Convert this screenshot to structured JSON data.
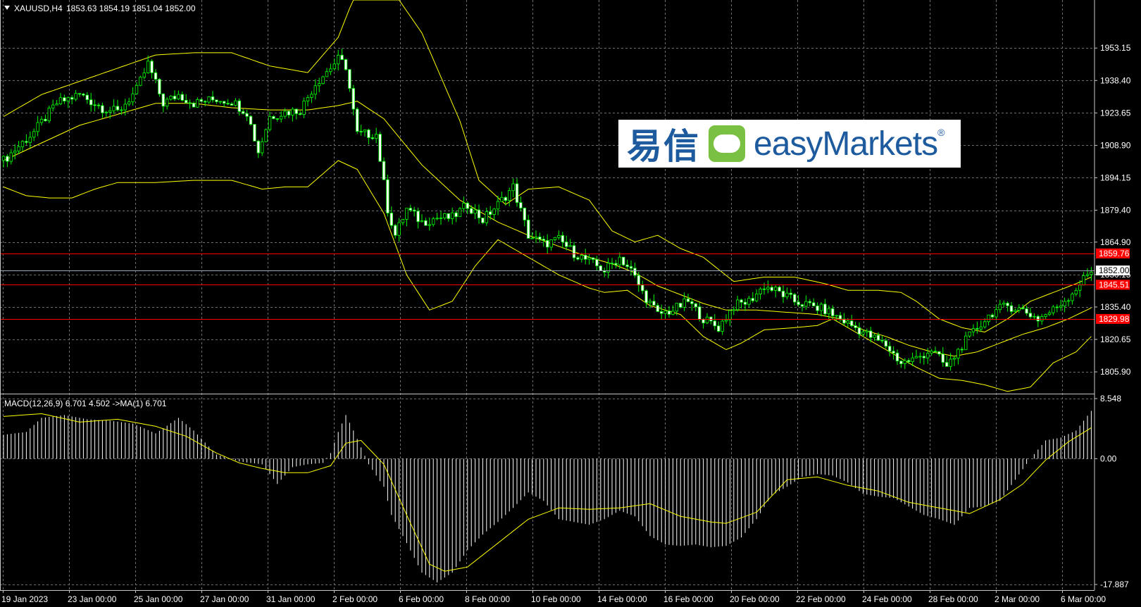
{
  "header": {
    "symbol": "XAUUSD,H4",
    "ohlc": "1853.63 1854.19 1851.04 1852.00"
  },
  "macd_label": "MACD(12,26,9) 6.701 4.502  ->MA(1) 6.701",
  "logo": {
    "cn": "易信",
    "en": "easyMarkets",
    "reg": "®"
  },
  "colors": {
    "background": "#000000",
    "grid": "#6e6e6e",
    "bull": "#00ff00",
    "bear": "#ffffff",
    "bands": "#ffff00",
    "level_lines": "#ff0000",
    "price_line": "#9aa8b8",
    "macd_hist": "#ffffff",
    "macd_signal": "#ffff00"
  },
  "chart_data": [
    {
      "type": "candlestick",
      "title": "XAUUSD,H4",
      "ylim": [
        1796,
        1975
      ],
      "y_ticks": [
        "1953.15",
        "1938.40",
        "1923.65",
        "1908.90",
        "1894.15",
        "1879.40",
        "1864.90",
        "1850.15",
        "1835.40",
        "1820.65",
        "1805.90"
      ],
      "x_labels": [
        "19 Jan 2023",
        "23 Jan 00:00",
        "25 Jan 00:00",
        "27 Jan 00:00",
        "31 Jan 00:00",
        "2 Feb 00:00",
        "6 Feb 00:00",
        "8 Feb 00:00",
        "10 Feb 00:00",
        "14 Feb 00:00",
        "16 Feb 00:00",
        "20 Feb 00:00",
        "22 Feb 00:00",
        "24 Feb 00:00",
        "28 Feb 00:00",
        "2 Mar 00:00",
        "6 Mar 00:00"
      ],
      "current_price": "1852.00",
      "levels": [
        "1859.76",
        "1845.51",
        "1829.98"
      ],
      "close_path": [
        [
          0,
          1902
        ],
        [
          8,
          1915
        ],
        [
          14,
          1928
        ],
        [
          20,
          1932
        ],
        [
          26,
          1926
        ],
        [
          30,
          1924
        ],
        [
          35,
          1934
        ],
        [
          38,
          1946
        ],
        [
          42,
          1928
        ],
        [
          46,
          1932
        ],
        [
          50,
          1928
        ],
        [
          56,
          1930
        ],
        [
          60,
          1929
        ],
        [
          64,
          1924
        ],
        [
          67,
          1906
        ],
        [
          70,
          1922
        ],
        [
          74,
          1924
        ],
        [
          78,
          1925
        ],
        [
          82,
          1937
        ],
        [
          88,
          1948
        ],
        [
          90,
          1945
        ],
        [
          93,
          1914
        ],
        [
          98,
          1914
        ],
        [
          101,
          1880
        ],
        [
          103,
          1868
        ],
        [
          106,
          1880
        ],
        [
          110,
          1874
        ],
        [
          114,
          1876
        ],
        [
          118,
          1876
        ],
        [
          122,
          1882
        ],
        [
          126,
          1875
        ],
        [
          130,
          1882
        ],
        [
          134,
          1890
        ],
        [
          138,
          1868
        ],
        [
          142,
          1864
        ],
        [
          146,
          1866
        ],
        [
          150,
          1860
        ],
        [
          154,
          1856
        ],
        [
          158,
          1852
        ],
        [
          162,
          1858
        ],
        [
          165,
          1852
        ],
        [
          168,
          1842
        ],
        [
          172,
          1832
        ],
        [
          176,
          1834
        ],
        [
          180,
          1838
        ],
        [
          184,
          1830
        ],
        [
          188,
          1826
        ],
        [
          192,
          1836
        ],
        [
          196,
          1838
        ],
        [
          200,
          1845
        ],
        [
          204,
          1842
        ],
        [
          208,
          1838
        ],
        [
          212,
          1836
        ],
        [
          216,
          1834
        ],
        [
          220,
          1830
        ],
        [
          224,
          1826
        ],
        [
          228,
          1822
        ],
        [
          232,
          1818
        ],
        [
          236,
          1810
        ],
        [
          240,
          1812
        ],
        [
          244,
          1816
        ],
        [
          248,
          1808
        ],
        [
          252,
          1818
        ],
        [
          256,
          1826
        ],
        [
          260,
          1833
        ],
        [
          264,
          1836
        ],
        [
          268,
          1834
        ],
        [
          272,
          1830
        ],
        [
          276,
          1834
        ],
        [
          280,
          1840
        ],
        [
          284,
          1848
        ],
        [
          286,
          1852
        ]
      ],
      "bb_upper": [
        [
          0,
          1922
        ],
        [
          10,
          1932
        ],
        [
          20,
          1938
        ],
        [
          30,
          1944
        ],
        [
          40,
          1950
        ],
        [
          50,
          1951
        ],
        [
          60,
          1951
        ],
        [
          70,
          1945
        ],
        [
          80,
          1942
        ],
        [
          88,
          1958
        ],
        [
          93,
          1980
        ],
        [
          100,
          1985
        ],
        [
          110,
          1960
        ],
        [
          120,
          1920
        ],
        [
          125,
          1893
        ],
        [
          132,
          1882
        ],
        [
          138,
          1889
        ],
        [
          146,
          1890
        ],
        [
          154,
          1884
        ],
        [
          160,
          1870
        ],
        [
          166,
          1865
        ],
        [
          172,
          1868
        ],
        [
          178,
          1862
        ],
        [
          184,
          1858
        ],
        [
          192,
          1847
        ],
        [
          200,
          1849
        ],
        [
          208,
          1849
        ],
        [
          216,
          1846
        ],
        [
          222,
          1843
        ],
        [
          230,
          1843
        ],
        [
          236,
          1842
        ],
        [
          240,
          1838
        ],
        [
          246,
          1830
        ],
        [
          252,
          1826
        ],
        [
          258,
          1824
        ],
        [
          264,
          1830
        ],
        [
          270,
          1838
        ],
        [
          276,
          1842
        ],
        [
          282,
          1846
        ],
        [
          286,
          1849
        ]
      ],
      "bb_middle": [
        [
          0,
          1902
        ],
        [
          10,
          1910
        ],
        [
          20,
          1918
        ],
        [
          30,
          1923
        ],
        [
          40,
          1928
        ],
        [
          50,
          1928
        ],
        [
          60,
          1926
        ],
        [
          70,
          1925
        ],
        [
          80,
          1925
        ],
        [
          88,
          1927
        ],
        [
          93,
          1929
        ],
        [
          100,
          1921
        ],
        [
          110,
          1900
        ],
        [
          120,
          1884
        ],
        [
          130,
          1874
        ],
        [
          138,
          1868
        ],
        [
          146,
          1863
        ],
        [
          154,
          1858
        ],
        [
          160,
          1855
        ],
        [
          166,
          1851
        ],
        [
          172,
          1845
        ],
        [
          178,
          1841
        ],
        [
          184,
          1837
        ],
        [
          190,
          1834
        ],
        [
          198,
          1834
        ],
        [
          206,
          1833
        ],
        [
          214,
          1832
        ],
        [
          220,
          1830
        ],
        [
          226,
          1825
        ],
        [
          232,
          1822
        ],
        [
          238,
          1818
        ],
        [
          244,
          1815
        ],
        [
          250,
          1813
        ],
        [
          256,
          1815
        ],
        [
          262,
          1819
        ],
        [
          268,
          1823
        ],
        [
          274,
          1826
        ],
        [
          280,
          1830
        ],
        [
          286,
          1835
        ]
      ],
      "bb_lower": [
        [
          0,
          1890
        ],
        [
          6,
          1886
        ],
        [
          12,
          1885
        ],
        [
          18,
          1885
        ],
        [
          24,
          1889
        ],
        [
          30,
          1892
        ],
        [
          40,
          1892
        ],
        [
          50,
          1893
        ],
        [
          60,
          1893
        ],
        [
          68,
          1889
        ],
        [
          74,
          1890
        ],
        [
          80,
          1890
        ],
        [
          88,
          1902
        ],
        [
          93,
          1898
        ],
        [
          100,
          1878
        ],
        [
          106,
          1850
        ],
        [
          112,
          1834
        ],
        [
          118,
          1838
        ],
        [
          124,
          1854
        ],
        [
          130,
          1866
        ],
        [
          138,
          1858
        ],
        [
          146,
          1850
        ],
        [
          154,
          1844
        ],
        [
          158,
          1842
        ],
        [
          164,
          1843
        ],
        [
          170,
          1836
        ],
        [
          178,
          1832
        ],
        [
          184,
          1822
        ],
        [
          190,
          1816
        ],
        [
          194,
          1819
        ],
        [
          200,
          1825
        ],
        [
          208,
          1826
        ],
        [
          214,
          1827
        ],
        [
          218,
          1830
        ],
        [
          226,
          1822
        ],
        [
          232,
          1816
        ],
        [
          240,
          1808
        ],
        [
          246,
          1803
        ],
        [
          252,
          1802
        ],
        [
          258,
          1800
        ],
        [
          264,
          1797
        ],
        [
          270,
          1799
        ],
        [
          276,
          1810
        ],
        [
          282,
          1815
        ],
        [
          286,
          1822
        ]
      ]
    },
    {
      "type": "histogram",
      "title": "MACD(12,26,9)",
      "ylim": [
        -17.887,
        8.548
      ],
      "y_ticks": [
        "8.548",
        "0.00",
        "-17.887"
      ],
      "histogram": [
        [
          0,
          3.4
        ],
        [
          6,
          3.8
        ],
        [
          10,
          5.8
        ],
        [
          16,
          6.2
        ],
        [
          22,
          5.6
        ],
        [
          28,
          5.4
        ],
        [
          34,
          5.0
        ],
        [
          40,
          3.6
        ],
        [
          46,
          5.8
        ],
        [
          50,
          4.0
        ],
        [
          56,
          0.6
        ],
        [
          62,
          -0.4
        ],
        [
          68,
          -0.8
        ],
        [
          72,
          -3.6
        ],
        [
          76,
          -1.2
        ],
        [
          80,
          -0.8
        ],
        [
          84,
          -0.6
        ],
        [
          86,
          0.8
        ],
        [
          88,
          3.8
        ],
        [
          90,
          6.2
        ],
        [
          92,
          4.0
        ],
        [
          96,
          -0.8
        ],
        [
          100,
          -4.0
        ],
        [
          102,
          -8.0
        ],
        [
          106,
          -12.0
        ],
        [
          110,
          -16.2
        ],
        [
          114,
          -17.6
        ],
        [
          118,
          -16.2
        ],
        [
          122,
          -13.0
        ],
        [
          126,
          -10.8
        ],
        [
          130,
          -9.0
        ],
        [
          134,
          -7.0
        ],
        [
          138,
          -4.8
        ],
        [
          142,
          -6.0
        ],
        [
          146,
          -8.6
        ],
        [
          150,
          -9.0
        ],
        [
          154,
          -9.4
        ],
        [
          158,
          -8.6
        ],
        [
          162,
          -7.4
        ],
        [
          166,
          -8.2
        ],
        [
          170,
          -11.0
        ],
        [
          174,
          -12.2
        ],
        [
          178,
          -12.4
        ],
        [
          182,
          -12.2
        ],
        [
          186,
          -12.6
        ],
        [
          190,
          -12.4
        ],
        [
          194,
          -11.2
        ],
        [
          198,
          -8.6
        ],
        [
          202,
          -5.2
        ],
        [
          206,
          -4.0
        ],
        [
          210,
          -2.6
        ],
        [
          214,
          -2.2
        ],
        [
          218,
          -2.4
        ],
        [
          222,
          -3.4
        ],
        [
          226,
          -5.0
        ],
        [
          230,
          -5.4
        ],
        [
          234,
          -5.6
        ],
        [
          238,
          -6.8
        ],
        [
          242,
          -8.0
        ],
        [
          246,
          -8.6
        ],
        [
          250,
          -9.4
        ],
        [
          254,
          -7.0
        ],
        [
          258,
          -6.8
        ],
        [
          262,
          -6.0
        ],
        [
          266,
          -3.0
        ],
        [
          270,
          0.0
        ],
        [
          274,
          2.6
        ],
        [
          278,
          3.0
        ],
        [
          282,
          4.0
        ],
        [
          286,
          6.8
        ]
      ],
      "signal": [
        [
          0,
          6.0
        ],
        [
          10,
          6.4
        ],
        [
          20,
          5.2
        ],
        [
          30,
          5.6
        ],
        [
          40,
          4.6
        ],
        [
          48,
          3.2
        ],
        [
          56,
          0.8
        ],
        [
          62,
          -0.6
        ],
        [
          68,
          -1.4
        ],
        [
          74,
          -2.0
        ],
        [
          80,
          -2.0
        ],
        [
          86,
          -1.0
        ],
        [
          90,
          2.2
        ],
        [
          94,
          2.6
        ],
        [
          100,
          -0.8
        ],
        [
          106,
          -8.0
        ],
        [
          112,
          -15.0
        ],
        [
          116,
          -16.0
        ],
        [
          122,
          -15.4
        ],
        [
          130,
          -12.0
        ],
        [
          138,
          -8.6
        ],
        [
          146,
          -7.0
        ],
        [
          154,
          -7.2
        ],
        [
          162,
          -7.0
        ],
        [
          170,
          -6.4
        ],
        [
          178,
          -8.2
        ],
        [
          186,
          -9.0
        ],
        [
          190,
          -9.2
        ],
        [
          198,
          -7.6
        ],
        [
          206,
          -3.0
        ],
        [
          214,
          -2.6
        ],
        [
          222,
          -3.8
        ],
        [
          230,
          -4.6
        ],
        [
          238,
          -6.2
        ],
        [
          246,
          -7.0
        ],
        [
          254,
          -7.8
        ],
        [
          262,
          -5.8
        ],
        [
          268,
          -3.6
        ],
        [
          274,
          -0.2
        ],
        [
          280,
          2.4
        ],
        [
          286,
          4.4
        ]
      ]
    }
  ]
}
